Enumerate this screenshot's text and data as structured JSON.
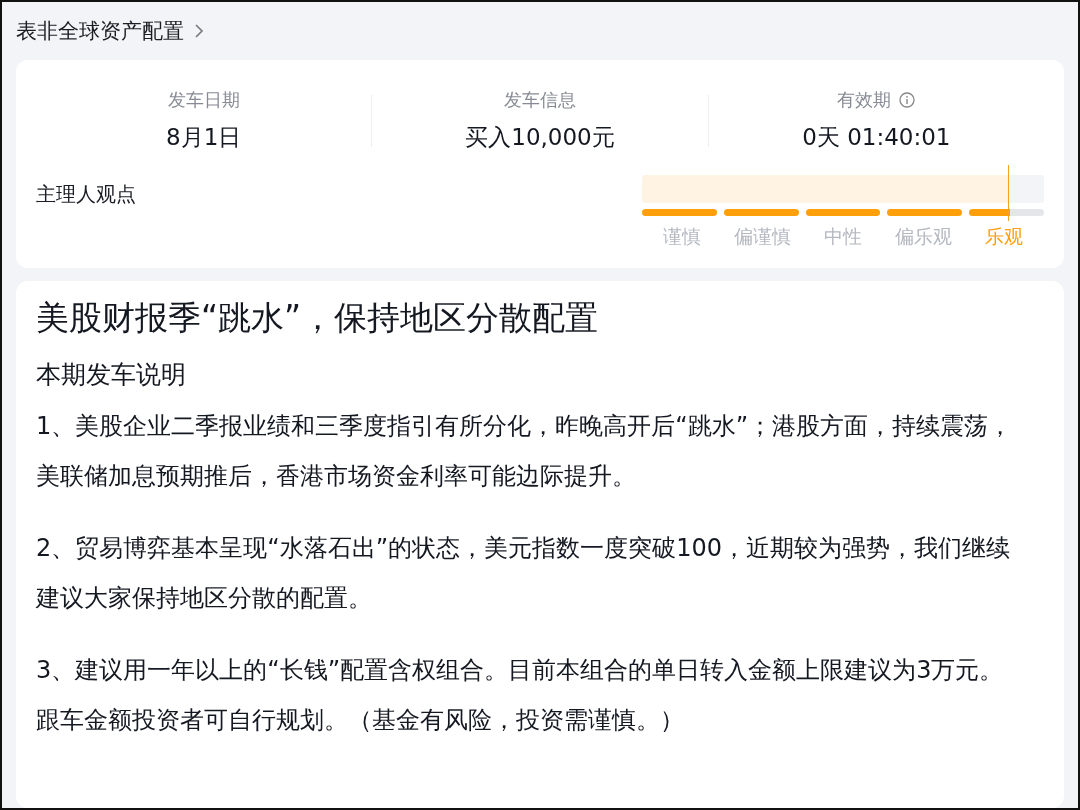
{
  "breadcrumb": {
    "title": "表非全球资产配置"
  },
  "stats": [
    {
      "label": "发车日期",
      "value": "8月1日",
      "info": false
    },
    {
      "label": "发车信息",
      "value": "买入10,000元",
      "info": false
    },
    {
      "label": "有效期",
      "value": "0天 01:40:01",
      "info": true
    }
  ],
  "opinion": {
    "label": "主理人观点",
    "level": 0.91,
    "steps": [
      {
        "label": "谨慎",
        "selected": false
      },
      {
        "label": "偏谨慎",
        "selected": false
      },
      {
        "label": "中性",
        "selected": false
      },
      {
        "label": "偏乐观",
        "selected": false
      },
      {
        "label": "乐观",
        "selected": true
      }
    ]
  },
  "article": {
    "title": "美股财报季“跳水”，保持地区分散配置",
    "subtitle": "本期发车说明",
    "paragraphs": [
      "1、美股企业二季报业绩和三季度指引有所分化，昨晚高开后“跳水”；港股方面，持续震荡，美联储加息预期推后，香港市场资金利率可能边际提升。",
      "2、贸易博弈基本呈现“水落石出”的状态，美元指数一度突破100，近期较为强势，我们继续建议大家保持地区分散的配置。",
      "3、建议用一年以上的“长钱”配置含权组合。目前本组合的单日转入金额上限建议为3万元。跟车金额投资者可自行规划。（基金有风险，投资需谨慎。）"
    ]
  }
}
